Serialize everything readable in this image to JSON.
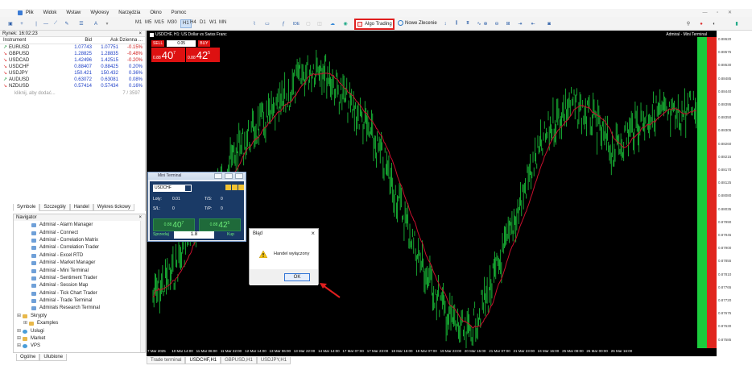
{
  "menu": {
    "items": [
      "Plik",
      "Widok",
      "Wstaw",
      "Wykresy",
      "Narzędzia",
      "Okno",
      "Pomoc"
    ]
  },
  "toolbar": {
    "timeframes": [
      "M1",
      "M5",
      "M15",
      "M30",
      "H1",
      "H4",
      "D1",
      "W1",
      "MN"
    ],
    "active_timeframe": "H1",
    "ide": "IDE",
    "algo_trading": "Algo Trading",
    "new_order": "Nowe Zlecenie"
  },
  "market_watch": {
    "header": "Rynek: 16:02:23",
    "columns": [
      "Instrument",
      "Bid",
      "Ask",
      "Dzienna ..."
    ],
    "rows": [
      {
        "symbol": "EURUSD",
        "dir": "up",
        "bid": "1.07743",
        "ask": "1.07751",
        "change": "-0.15%",
        "pos": false
      },
      {
        "symbol": "GBPUSD",
        "dir": "down",
        "bid": "1.28825",
        "ask": "1.28835",
        "change": "-0.48%",
        "pos": false
      },
      {
        "symbol": "USDCAD",
        "dir": "down",
        "bid": "1.42496",
        "ask": "1.42515",
        "change": "-0.20%",
        "pos": false
      },
      {
        "symbol": "USDCHF",
        "dir": "down",
        "bid": "0.88407",
        "ask": "0.88425",
        "change": "0.20%",
        "pos": true
      },
      {
        "symbol": "USDJPY",
        "dir": "down",
        "bid": "150.421",
        "ask": "150.432",
        "change": "0.36%",
        "pos": true
      },
      {
        "symbol": "AUDUSD",
        "dir": "up",
        "bid": "0.63072",
        "ask": "0.63081",
        "change": "0.08%",
        "pos": true
      },
      {
        "symbol": "NZDUSD",
        "dir": "down",
        "bid": "0.57414",
        "ask": "0.57434",
        "change": "0.16%",
        "pos": true
      }
    ],
    "add": "kliknij, aby dodać...",
    "count": "7 / 3597",
    "tabs": [
      "Symbole",
      "Szczegóły",
      "Handel",
      "Wykres tickowy"
    ]
  },
  "navigator": {
    "title": "Navigator",
    "items": [
      "Admiral - Alarm Manager",
      "Admiral - Connect",
      "Admiral - Correlation Matrix",
      "Admiral - Correlation Trader",
      "Admiral - Excel RTD",
      "Admiral - Market Manager",
      "Admiral - Mini Terminal",
      "Admiral - Sentiment Trader",
      "Admiral - Session Map",
      "Admiral - Tick Chart Trader",
      "Admiral - Trade Terminal",
      "Admirals Research Terminal"
    ],
    "tree": [
      {
        "label": "Skrypty",
        "level": 0,
        "icon": "fold"
      },
      {
        "label": "Examples",
        "level": 1,
        "icon": "fold"
      },
      {
        "label": "Usługi",
        "level": 0,
        "icon": "gl"
      },
      {
        "label": "Market",
        "level": 0,
        "icon": "fold"
      },
      {
        "label": "VPS",
        "level": 0,
        "icon": "gl"
      }
    ],
    "tabs": [
      "Ogólne",
      "Ulubione"
    ]
  },
  "chart": {
    "title": "USDCHF, H1:  US Dollar vs Swiss Franc",
    "admiral": "Admiral - Mini Terminal",
    "sell": "SELL",
    "buy": "BUY",
    "lot": "0.05",
    "bid_small": "0.88",
    "bid_big": "40",
    "bid_sup": "7",
    "ask_small": "0.88",
    "ask_big": "42",
    "ask_sup": "5",
    "y_labels": [
      "0.88620",
      "0.88575",
      "0.88530",
      "0.88485",
      "0.88440",
      "0.88395",
      "0.88350",
      "0.88305",
      "0.88260",
      "0.88215",
      "0.88170",
      "0.88125",
      "0.88080",
      "0.88035",
      "0.87990",
      "0.87945",
      "0.87900",
      "0.87855",
      "0.87810",
      "0.87765",
      "0.87720",
      "0.87675",
      "0.87630",
      "0.87585"
    ],
    "x_labels": [
      "7 Mar 2025",
      "10 Mar 14:00",
      "11 Mar 06:00",
      "11 Mar 22:00",
      "12 Mar 14:00",
      "13 Mar 06:00",
      "13 Mar 22:00",
      "14 Mar 14:00",
      "17 Mar 07:00",
      "17 Mar 23:00",
      "18 Mar 15:00",
      "19 Mar 07:00",
      "19 Mar 23:00",
      "20 Mar 15:00",
      "21 Mar 07:00",
      "21 Mar 23:00",
      "24 Mar 16:00",
      "25 Mar 08:00",
      "26 Mar 00:00",
      "26 Mar 16:00"
    ],
    "tabs": [
      "Trade terminal",
      "USDCHF,H1",
      "GBPUSD,H1",
      "USDJPY,H1"
    ]
  },
  "mini_terminal": {
    "title": "Mini Terminal",
    "symbol": "USDCHF",
    "lots_label": "Loty:",
    "lots": "0.01",
    "ts_label": "T/S:",
    "ts": "0",
    "sl_label": "S/L:",
    "sl": "0",
    "tp_label": "T/P:",
    "tp": "0",
    "sell_small": "0.88",
    "sell_big": "40",
    "sell_sup": "7",
    "buy_small": "0.88",
    "buy_big": "42",
    "buy_sup": "5",
    "sell": "Sprzedaj",
    "buy": "Kup",
    "qty": "1.8"
  },
  "dialog": {
    "title": "Błąd",
    "message": "Handel wyłączony",
    "ok": "OK"
  },
  "colors": {
    "accent": "#e01f1f",
    "bid": "#1a3cc6",
    "candle": "#1bcc3c",
    "ma": "#c8102e"
  }
}
